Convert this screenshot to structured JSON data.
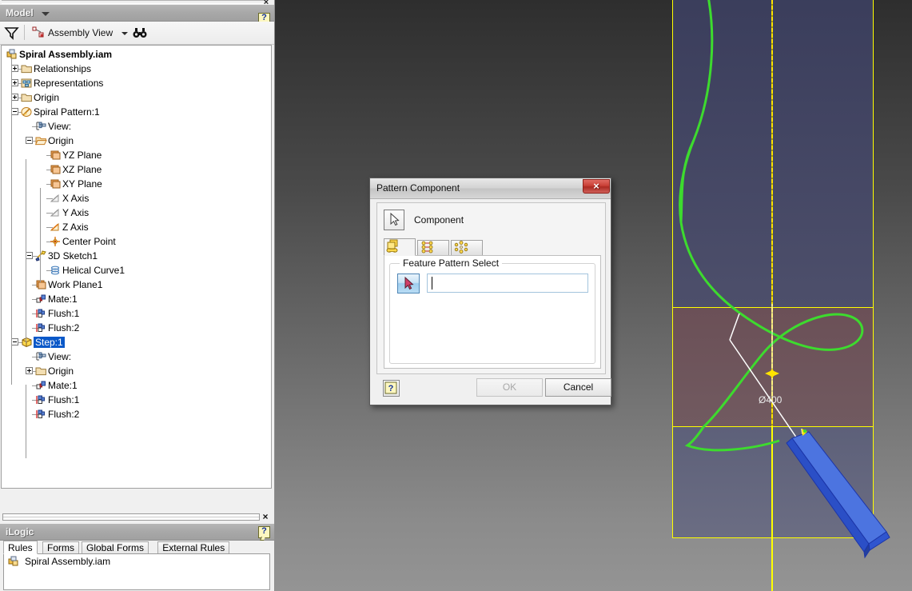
{
  "browser": {
    "title": "Model",
    "dropdown_caret": "chevron-down",
    "help_label": "?",
    "close_label": "×",
    "toolbar": {
      "filter_icon": "filter-icon",
      "view_mode": "Assembly View",
      "view_mode_caret": "chevron-down",
      "find_icon": "binoculars-icon"
    },
    "tree": [
      {
        "label": "Spiral Assembly.iam",
        "depth": 0,
        "icon": "assembly-icon",
        "expander": "none",
        "bold": true,
        "selected": false
      },
      {
        "label": "Relationships",
        "depth": 1,
        "icon": "folder-icon",
        "expander": "plus",
        "bold": false,
        "selected": false
      },
      {
        "label": "Representations",
        "depth": 1,
        "icon": "representations-icon",
        "expander": "plus",
        "bold": false,
        "selected": false
      },
      {
        "label": "Origin",
        "depth": 1,
        "icon": "folder-icon",
        "expander": "plus",
        "bold": false,
        "selected": false
      },
      {
        "label": "Spiral Pattern:1",
        "depth": 1,
        "icon": "part-icon",
        "expander": "minus",
        "bold": false,
        "selected": false
      },
      {
        "label": "View:",
        "depth": 2,
        "icon": "view-icon",
        "expander": "none",
        "bold": false,
        "selected": false
      },
      {
        "label": "Origin",
        "depth": 2,
        "icon": "folder-open-icon",
        "expander": "minus",
        "bold": false,
        "selected": false
      },
      {
        "label": "YZ Plane",
        "depth": 3,
        "icon": "plane-icon",
        "expander": "none",
        "bold": false,
        "selected": false
      },
      {
        "label": "XZ Plane",
        "depth": 3,
        "icon": "plane-icon",
        "expander": "none",
        "bold": false,
        "selected": false
      },
      {
        "label": "XY Plane",
        "depth": 3,
        "icon": "plane-icon",
        "expander": "none",
        "bold": false,
        "selected": false
      },
      {
        "label": "X Axis",
        "depth": 3,
        "icon": "axis-gray-icon",
        "expander": "none",
        "bold": false,
        "selected": false
      },
      {
        "label": "Y Axis",
        "depth": 3,
        "icon": "axis-gray-icon",
        "expander": "none",
        "bold": false,
        "selected": false
      },
      {
        "label": "Z Axis",
        "depth": 3,
        "icon": "axis-orange-icon",
        "expander": "none",
        "bold": false,
        "selected": false
      },
      {
        "label": "Center Point",
        "depth": 3,
        "icon": "center-point-icon",
        "expander": "none",
        "bold": false,
        "selected": false
      },
      {
        "label": "3D Sketch1",
        "depth": 2,
        "icon": "sketch3d-icon",
        "expander": "minus",
        "bold": false,
        "selected": false
      },
      {
        "label": "Helical Curve1",
        "depth": 3,
        "icon": "helix-icon",
        "expander": "none",
        "bold": false,
        "selected": false
      },
      {
        "label": "Work Plane1",
        "depth": 2,
        "icon": "plane-icon",
        "expander": "none",
        "bold": false,
        "selected": false
      },
      {
        "label": "Mate:1",
        "depth": 2,
        "icon": "mate-icon",
        "expander": "none",
        "bold": false,
        "selected": false
      },
      {
        "label": "Flush:1",
        "depth": 2,
        "icon": "flush-icon",
        "expander": "none",
        "bold": false,
        "selected": false
      },
      {
        "label": "Flush:2",
        "depth": 2,
        "icon": "flush-icon",
        "expander": "none",
        "bold": false,
        "selected": false
      },
      {
        "label": "Step:1",
        "depth": 1,
        "icon": "part-yellow-icon",
        "expander": "minus",
        "bold": false,
        "selected": true
      },
      {
        "label": "View:",
        "depth": 2,
        "icon": "view-icon",
        "expander": "none",
        "bold": false,
        "selected": false
      },
      {
        "label": "Origin",
        "depth": 2,
        "icon": "folder-icon",
        "expander": "plus",
        "bold": false,
        "selected": false
      },
      {
        "label": "Mate:1",
        "depth": 2,
        "icon": "mate-icon",
        "expander": "none",
        "bold": false,
        "selected": false
      },
      {
        "label": "Flush:1",
        "depth": 2,
        "icon": "flush-icon",
        "expander": "none",
        "bold": false,
        "selected": false
      },
      {
        "label": "Flush:2",
        "depth": 2,
        "icon": "flush-icon",
        "expander": "none",
        "bold": false,
        "selected": false
      }
    ]
  },
  "ilogic": {
    "title": "iLogic",
    "help_label": "?",
    "close_label": "×",
    "tabs": [
      {
        "label": "Rules",
        "active": true
      },
      {
        "label": "Forms",
        "active": false
      },
      {
        "label": "Global Forms",
        "active": false
      },
      {
        "label": "External Rules",
        "active": false
      }
    ],
    "rows": [
      {
        "label": "Spiral Assembly.iam",
        "icon": "assembly-icon"
      }
    ]
  },
  "dialog": {
    "title": "Pattern Component",
    "close_label": "×",
    "component_label": "Component",
    "component_icon": "arrow-cursor-icon",
    "tabs": [
      {
        "name": "feature-pattern-tab",
        "active": true
      },
      {
        "name": "rectangular-pattern-tab",
        "active": false
      },
      {
        "name": "circular-pattern-tab",
        "active": false
      }
    ],
    "group_legend": "Feature Pattern Select",
    "pick_button_icon": "select-cursor-icon",
    "pick_input_value": "",
    "pick_input_placeholder": "",
    "help_label": "?",
    "ok_label": "OK",
    "cancel_label": "Cancel"
  },
  "viewport": {
    "dimension_label": "Ø400",
    "curve_color": "#3ddb2e",
    "plane_border_color": "#ffff00",
    "axis_color": "#ffff00",
    "part_color": "#4a6fdc",
    "selected_point_color": "#ffff00"
  }
}
